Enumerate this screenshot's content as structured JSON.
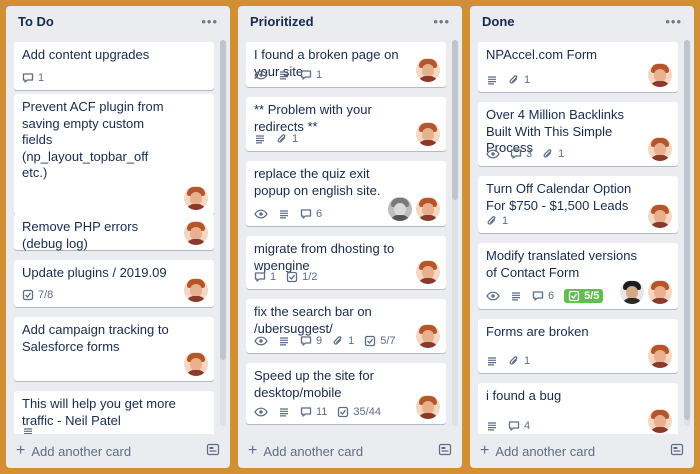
{
  "lists": [
    {
      "title": "To Do",
      "cards": [
        {
          "title": "Add content upgrades",
          "badges": [
            {
              "icon": "comment-icon",
              "text": "1"
            }
          ],
          "members": []
        },
        {
          "title": "Prevent ACF plugin from saving empty custom fields (np_layout_topbar_off etc.)",
          "badges": [],
          "members": [
            "neil"
          ]
        },
        {
          "title": "Remove PHP errors (debug log)",
          "badges": [],
          "members": [
            "neil"
          ]
        },
        {
          "title": "Update plugins / 2019.09",
          "badges": [
            {
              "icon": "checklist-icon",
              "text": "7/8"
            }
          ],
          "members": [
            "neil"
          ]
        },
        {
          "title": "Add campaign tracking to Salesforce forms",
          "badges": [],
          "members": [
            "neil"
          ]
        },
        {
          "title": "This will help you get more traffic - Neil Patel",
          "badges": [
            {
              "icon": "description-icon",
              "text": ""
            }
          ],
          "members": []
        }
      ],
      "add_label": "Add another card"
    },
    {
      "title": "Prioritized",
      "cards": [
        {
          "title": "I found a broken page on your site",
          "badges": [
            {
              "icon": "watch-icon",
              "text": ""
            },
            {
              "icon": "description-icon",
              "text": ""
            },
            {
              "icon": "comment-icon",
              "text": "1"
            }
          ],
          "members": [
            "neil"
          ]
        },
        {
          "title": "** Problem with your redirects **",
          "badges": [
            {
              "icon": "description-icon",
              "text": ""
            },
            {
              "icon": "attachment-icon",
              "text": "1"
            }
          ],
          "members": [
            "neil"
          ]
        },
        {
          "title": "replace the quiz exit popup on english site.",
          "badges": [
            {
              "icon": "watch-icon",
              "text": ""
            },
            {
              "icon": "description-icon",
              "text": ""
            },
            {
              "icon": "comment-icon",
              "text": "6"
            }
          ],
          "members": [
            "gray",
            "neil"
          ]
        },
        {
          "title": "migrate from dhosting to wpengine",
          "badges": [
            {
              "icon": "comment-icon",
              "text": "1"
            },
            {
              "icon": "checklist-icon",
              "text": "1/2"
            }
          ],
          "members": [
            "neil"
          ]
        },
        {
          "title": "fix the search bar on /ubersuggest/",
          "badges": [
            {
              "icon": "watch-icon",
              "text": ""
            },
            {
              "icon": "description-icon",
              "text": ""
            },
            {
              "icon": "comment-icon",
              "text": "9"
            },
            {
              "icon": "attachment-icon",
              "text": "1"
            },
            {
              "icon": "checklist-icon",
              "text": "5/7"
            }
          ],
          "members": [
            "neil"
          ]
        },
        {
          "title": "Speed up the site for desktop/mobile",
          "badges": [
            {
              "icon": "watch-icon",
              "text": ""
            },
            {
              "icon": "description-icon",
              "text": ""
            },
            {
              "icon": "comment-icon",
              "text": "11"
            },
            {
              "icon": "checklist-icon",
              "text": "35/44"
            }
          ],
          "members": [
            "neil"
          ]
        },
        {
          "title": "",
          "badges": [],
          "members": []
        }
      ],
      "add_label": "Add another card"
    },
    {
      "title": "Done",
      "cards": [
        {
          "title": "NPAccel.com Form",
          "badges": [
            {
              "icon": "description-icon",
              "text": ""
            },
            {
              "icon": "attachment-icon",
              "text": "1"
            }
          ],
          "members": [
            "neil"
          ]
        },
        {
          "title": "Over 4 Million Backlinks Built With This Simple Process",
          "badges": [
            {
              "icon": "watch-icon",
              "text": ""
            },
            {
              "icon": "comment-icon",
              "text": "3"
            },
            {
              "icon": "attachment-icon",
              "text": "1"
            }
          ],
          "members": [
            "neil"
          ]
        },
        {
          "title": "Turn Off Calendar Option For $750 - $1,500 Leads",
          "badges": [
            {
              "icon": "attachment-icon",
              "text": "1"
            }
          ],
          "members": [
            "neil"
          ]
        },
        {
          "title": "Modify translated versions of Contact Form",
          "badges": [
            {
              "icon": "watch-icon",
              "text": ""
            },
            {
              "icon": "description-icon",
              "text": ""
            },
            {
              "icon": "comment-icon",
              "text": "6"
            },
            {
              "icon": "checklist-done-icon",
              "text": "5/5"
            }
          ],
          "members": [
            "dark",
            "neil"
          ]
        },
        {
          "title": "Forms are broken",
          "badges": [
            {
              "icon": "description-icon",
              "text": ""
            },
            {
              "icon": "attachment-icon",
              "text": "1"
            }
          ],
          "members": [
            "neil"
          ]
        },
        {
          "title": "i found a bug",
          "badges": [
            {
              "icon": "description-icon",
              "text": ""
            },
            {
              "icon": "comment-icon",
              "text": "4"
            }
          ],
          "members": [
            "neil"
          ]
        }
      ],
      "add_label": "Add another card"
    }
  ],
  "colors": {
    "board_bg": "#d29034",
    "list_bg": "#ebecf0",
    "card_bg": "#ffffff",
    "text": "#172b4d",
    "muted": "#5e6c84",
    "checklist_done": "#61bd4f"
  }
}
